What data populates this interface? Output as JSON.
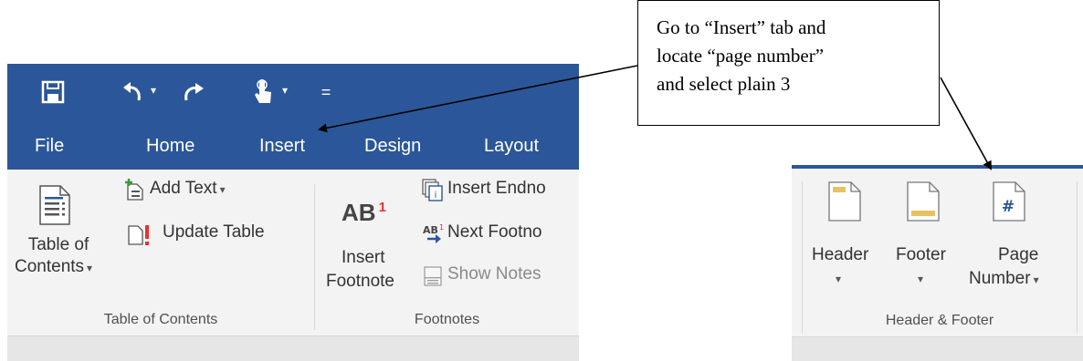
{
  "quick_access": {
    "icons": [
      "save-icon",
      "undo-icon",
      "redo-icon",
      "touch-mode-icon",
      "customize-qat-icon"
    ],
    "caret": "▾",
    "customize_glyph": "="
  },
  "tabs": [
    "File",
    "Home",
    "Insert",
    "Design",
    "Layout"
  ],
  "table_of_contents_group": {
    "toc_button_line1": "Table of",
    "toc_button_line2": "Contents",
    "add_text": "Add Text",
    "update_table": "Update Table",
    "label": "Table of Contents"
  },
  "footnotes_group": {
    "insert_footnote_icon_text": "AB",
    "insert_footnote_superscript": "1",
    "insert_footnote_line1": "Insert",
    "insert_footnote_line2": "Footnote",
    "insert_endnote": "Insert Endno",
    "next_footnote": "Next Footno",
    "show_notes": "Show Notes",
    "label": "Footnotes"
  },
  "header_footer_group": {
    "header": "Header",
    "footer": "Footer",
    "page_number_line1": "Page",
    "page_number_line2": "Number",
    "page_number_glyph": "#",
    "label": "Header & Footer"
  },
  "callout": {
    "line1": "Go to “Insert” tab and",
    "line2": "locate “page number”",
    "line3": "and select plain 3"
  },
  "colors": {
    "ribbon_blue": "#2b579a",
    "ribbon_body": "#f3f3f3",
    "accent_red": "#e8322d",
    "header_footer_accent": "#e8c262"
  }
}
